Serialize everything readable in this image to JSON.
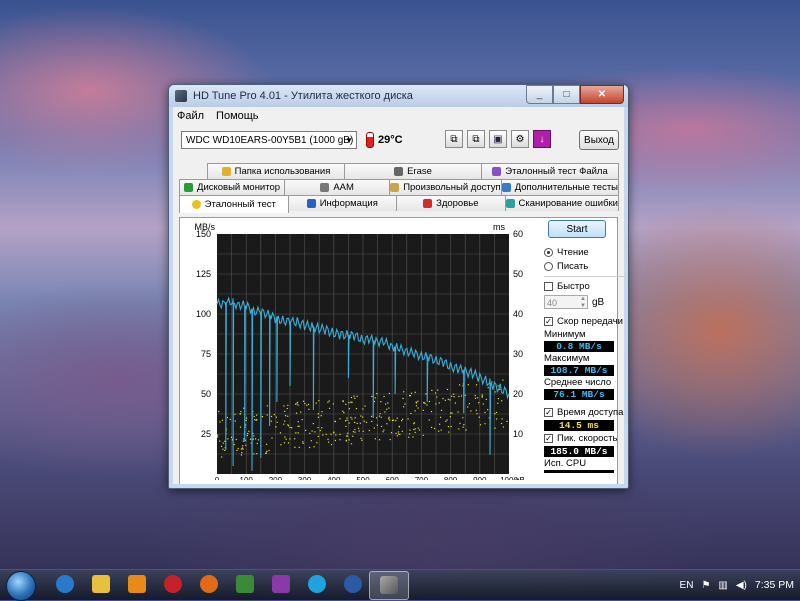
{
  "window": {
    "title": "HD Tune Pro 4.01 - Утилита жесткого диска",
    "min": "_",
    "max": "□",
    "close": "✕"
  },
  "menu": [
    "Файл",
    "Помощь"
  ],
  "toolbar": {
    "drive": "WDC WD10EARS-00Y5B1 (1000 gB)",
    "temperature": "29°C",
    "exit_label": "Выход"
  },
  "tabs": {
    "row1": [
      "Папка использования",
      "Erase",
      "Эталонный тест Файла"
    ],
    "row2": [
      "Дисковый монитор",
      "AAM",
      "Произвольный доступ",
      "Дополнительные тесты"
    ],
    "row3": [
      "Эталонный тест",
      "Информация",
      "Здоровье",
      "Сканирование ошибки"
    ]
  },
  "panel": {
    "start": "Start",
    "read": "Чтение",
    "write": "Писать",
    "fast": "Быстро",
    "block_value": "40",
    "block_unit": "gB",
    "transfer_rate": "Скор передачи",
    "min_label": "Минимум",
    "min_value": "0.8 MB/s",
    "max_label": "Максимум",
    "max_value": "108.7 MB/s",
    "avg_label": "Среднее число",
    "avg_value": "76.1 MB/s",
    "access_label": "Время доступа",
    "access_value": "14.5 ms",
    "burst_label": "Пик. скорость",
    "burst_value": "185.0 MB/s",
    "cpu_label": "Исп. CPU"
  },
  "chart_data": {
    "type": "line",
    "y_left_label": "MB/s",
    "y_right_label": "ms",
    "y_left_ticks": [
      25,
      50,
      75,
      100,
      125,
      150
    ],
    "y_right_ticks": [
      10,
      20,
      30,
      40,
      50,
      60
    ],
    "ylim_left": [
      0,
      150
    ],
    "ylim_right": [
      0,
      60
    ],
    "x_ticks": [
      0,
      100,
      200,
      300,
      400,
      500,
      600,
      700,
      800,
      900,
      1000
    ],
    "x_unit": "gB",
    "xlim": [
      0,
      1000
    ],
    "grid": true,
    "transfer_series": {
      "name": "Transfer rate",
      "color": "#3aaed8",
      "x": [
        0,
        25,
        50,
        75,
        100,
        125,
        150,
        175,
        200,
        225,
        250,
        275,
        300,
        325,
        350,
        375,
        400,
        425,
        450,
        475,
        500,
        525,
        550,
        575,
        600,
        625,
        650,
        675,
        700,
        725,
        750,
        775,
        800,
        825,
        850,
        875,
        900,
        925,
        950,
        975,
        1000
      ],
      "y": [
        106,
        107,
        107,
        106,
        105,
        102,
        101,
        100,
        97,
        96,
        95,
        95,
        93,
        92,
        91,
        90,
        88,
        87,
        87,
        86,
        84,
        84,
        83,
        82,
        80,
        78,
        77,
        75,
        74,
        73,
        71,
        70,
        67,
        66,
        64,
        63,
        60,
        58,
        55,
        53,
        50
      ]
    },
    "dips": [
      {
        "x": 30,
        "y": 15
      },
      {
        "x": 55,
        "y": 5
      },
      {
        "x": 95,
        "y": 20
      },
      {
        "x": 120,
        "y": 2
      },
      {
        "x": 150,
        "y": 10
      },
      {
        "x": 180,
        "y": 30
      },
      {
        "x": 205,
        "y": 45
      },
      {
        "x": 250,
        "y": 55
      },
      {
        "x": 330,
        "y": 40
      },
      {
        "x": 450,
        "y": 60
      },
      {
        "x": 535,
        "y": 35
      },
      {
        "x": 610,
        "y": 50
      },
      {
        "x": 720,
        "y": 45
      },
      {
        "x": 845,
        "y": 38
      },
      {
        "x": 935,
        "y": 12
      }
    ],
    "access_points": {
      "name": "Access time",
      "color": "#e8e03a",
      "count_hint": "scatter, ~10–22 ms rising with position"
    }
  },
  "taskbar": {
    "lang": "EN",
    "time": "7:35 PM"
  }
}
